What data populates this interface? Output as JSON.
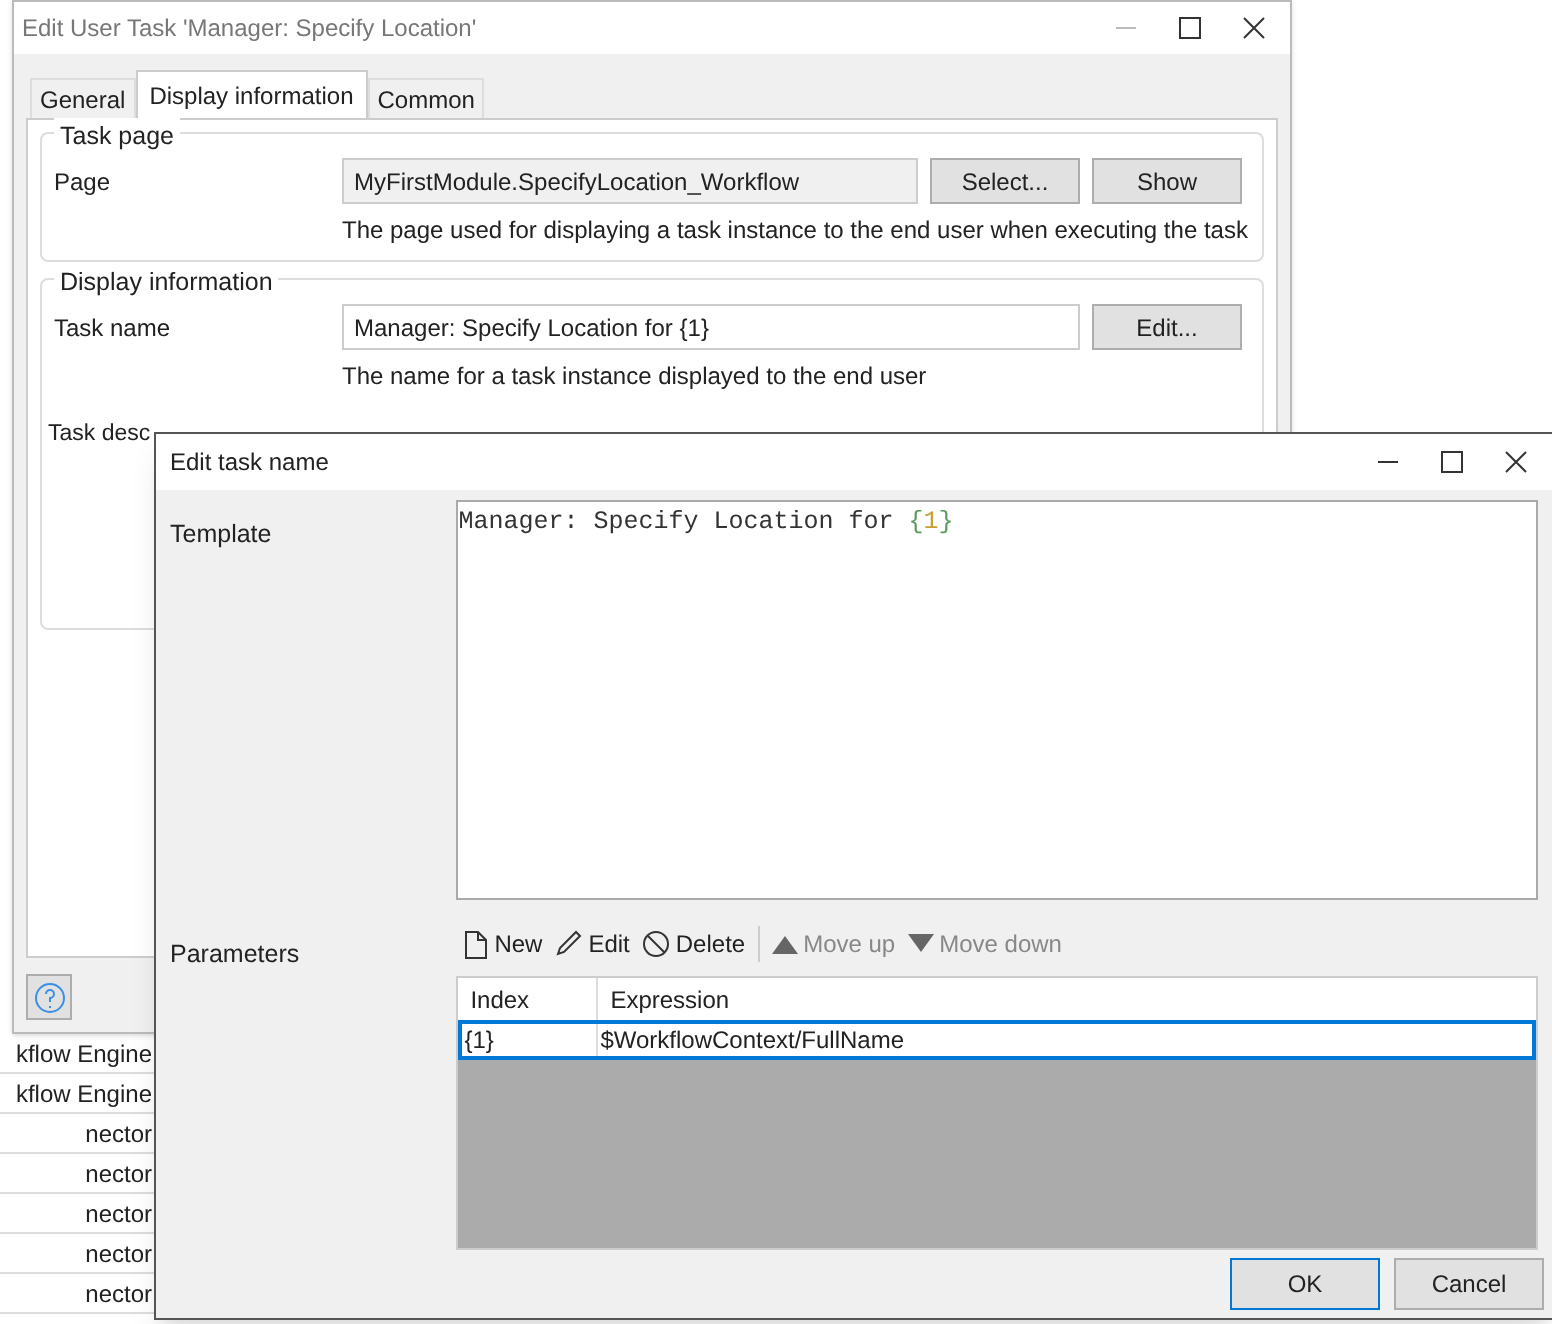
{
  "background_list": {
    "rows": [
      "kflow Engine",
      "kflow Engine",
      "nector",
      "nector",
      "nector",
      "nector",
      "nector"
    ]
  },
  "user_task_dialog": {
    "title": "Edit User Task 'Manager: Specify Location'",
    "tabs": [
      {
        "label": "General",
        "selected": false
      },
      {
        "label": "Display information",
        "selected": true
      },
      {
        "label": "Common",
        "selected": false
      }
    ],
    "task_page": {
      "legend": "Task page",
      "label": "Page",
      "value": "MyFirstModule.SpecifyLocation_Workflow",
      "buttons": [
        "Select...",
        "Show"
      ],
      "hint": "The page used for displaying a task instance to the end user when executing the task"
    },
    "display_information": {
      "legend": "Display information",
      "task_name_label": "Task name",
      "task_name_value": "Manager: Specify Location for {1}",
      "edit_button": "Edit...",
      "hint": "The name for a task instance displayed to the end user",
      "task_description_label": "Task desc"
    }
  },
  "edit_task_name_dialog": {
    "title": "Edit task name",
    "template_label": "Template",
    "template": [
      {
        "kind": "plain",
        "text": "Manager: Specify Location for "
      },
      {
        "kind": "brace",
        "text": "{"
      },
      {
        "kind": "index",
        "text": "1"
      },
      {
        "kind": "brace",
        "text": "}"
      }
    ],
    "parameters_label": "Parameters",
    "toolbar": [
      {
        "kind": "new",
        "label": "New",
        "disabled": false
      },
      {
        "kind": "edit",
        "label": "Edit",
        "disabled": false
      },
      {
        "kind": "delete",
        "label": "Delete",
        "disabled": false
      },
      {
        "kind": "up",
        "label": "Move up",
        "disabled": true
      },
      {
        "kind": "down",
        "label": "Move down",
        "disabled": true
      }
    ],
    "table": {
      "columns": [
        "Index",
        "Expression"
      ],
      "rows": [
        {
          "cells": [
            "{1}",
            "$WorkflowContext/FullName"
          ],
          "selected": true
        }
      ]
    },
    "buttons": [
      {
        "label": "OK",
        "default": true
      },
      {
        "label": "Cancel",
        "default": false
      }
    ]
  }
}
